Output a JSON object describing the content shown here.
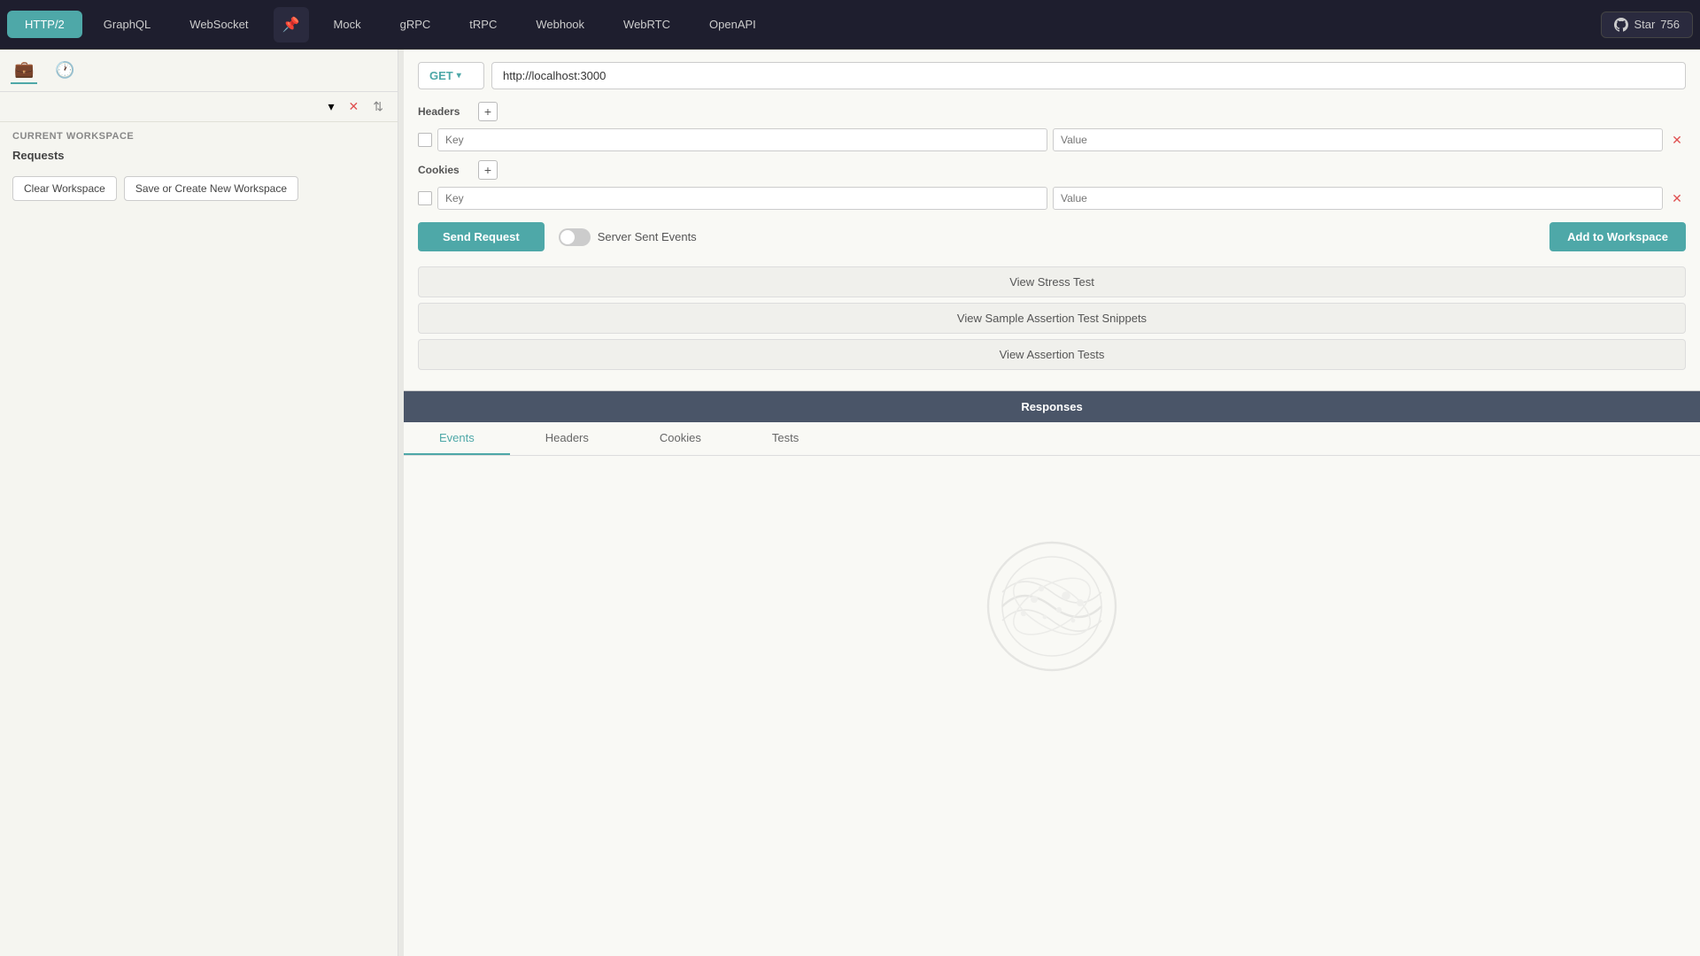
{
  "nav": {
    "tabs": [
      {
        "id": "http2",
        "label": "HTTP/2",
        "active": true
      },
      {
        "id": "graphql",
        "label": "GraphQL",
        "active": false
      },
      {
        "id": "websocket",
        "label": "WebSocket",
        "active": false
      },
      {
        "id": "mock",
        "label": "Mock",
        "active": false
      },
      {
        "id": "grpc",
        "label": "gRPC",
        "active": false
      },
      {
        "id": "trpc",
        "label": "tRPC",
        "active": false
      },
      {
        "id": "webhook",
        "label": "Webhook",
        "active": false
      },
      {
        "id": "webrtc",
        "label": "WebRTC",
        "active": false
      },
      {
        "id": "openapi",
        "label": "OpenAPI",
        "active": false
      }
    ],
    "github_star": "Star",
    "github_count": "756"
  },
  "sidebar": {
    "workspace_name": "",
    "workspace_placeholder": "",
    "current_workspace_label": "Current Workspace",
    "requests_label": "Requests",
    "clear_workspace_btn": "Clear Workspace",
    "save_workspace_btn": "Save or Create New Workspace"
  },
  "request": {
    "method": "GET",
    "url": "http://localhost:3000",
    "headers_label": "Headers",
    "cookies_label": "Cookies",
    "header_key_placeholder": "Key",
    "header_value_placeholder": "Value",
    "cookie_key_placeholder": "Key",
    "cookie_value_placeholder": "Value",
    "send_btn": "Send Request",
    "sse_label": "Server Sent Events",
    "add_workspace_btn": "Add to Workspace",
    "stress_test_btn": "View Stress Test",
    "assertion_snippets_btn": "View Sample Assertion Test Snippets",
    "assertion_tests_btn": "View Assertion Tests"
  },
  "responses": {
    "header": "Responses",
    "tabs": [
      {
        "id": "events",
        "label": "Events",
        "active": true
      },
      {
        "id": "headers",
        "label": "Headers",
        "active": false
      },
      {
        "id": "cookies",
        "label": "Cookies",
        "active": false
      },
      {
        "id": "tests",
        "label": "Tests",
        "active": false
      }
    ]
  },
  "colors": {
    "accent": "#4ea8a8",
    "nav_bg": "#1e1e2e",
    "sidebar_bg": "#f5f5f0",
    "content_bg": "#f9f9f5"
  }
}
